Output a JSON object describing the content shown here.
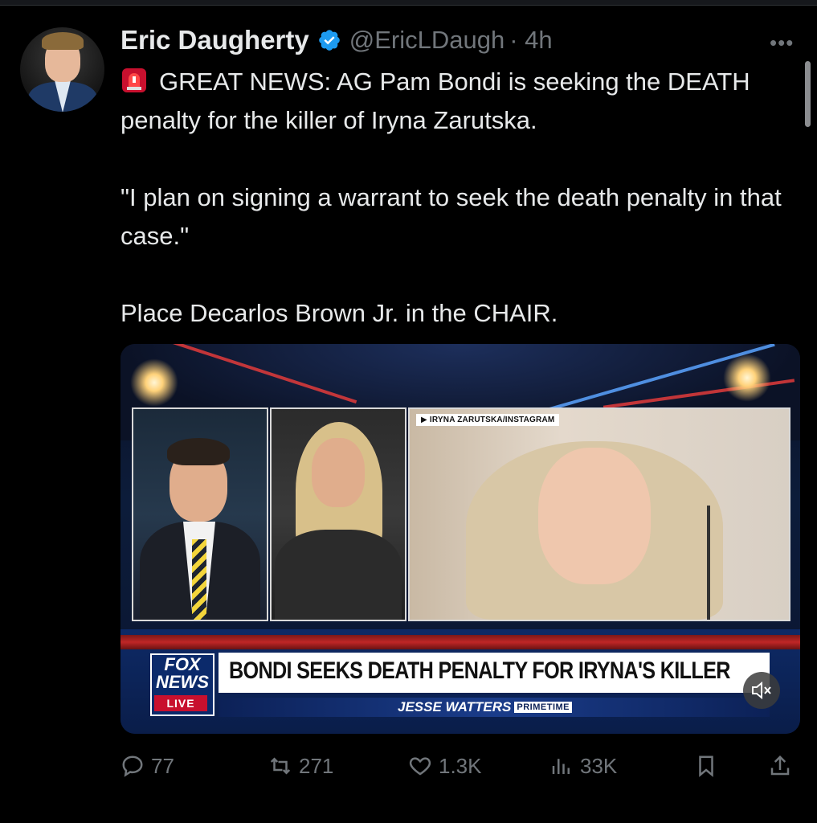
{
  "tweet": {
    "author": {
      "name": "Eric Daugherty",
      "handle": "@EricLDaugh",
      "time": "· 4h",
      "verified": true
    },
    "text": {
      "line1_emoji": "siren-emoji",
      "line1": "GREAT NEWS: AG Pam Bondi is seeking the DEATH penalty for the killer of Iryna Zarutska.",
      "line2": "\"I plan on signing a warrant to seek the death penalty in that case.\"",
      "line3": "Place Decarlos Brown Jr. in the CHAIR."
    },
    "media": {
      "credit": "▶ IRYNA ZARUTSKA/INSTAGRAM",
      "logo_top": "FOX",
      "logo_bottom": "NEWS",
      "logo_live": "LIVE",
      "headline": "BONDI SEEKS DEATH PENALTY FOR IRYNA'S KILLER",
      "show": "JESSE WATTERS",
      "show_tag": "PRIMETIME"
    },
    "actions": {
      "replies": "77",
      "reposts": "271",
      "likes": "1.3K",
      "views": "33K"
    },
    "more_label": "•••"
  },
  "colors": {
    "background": "#000000",
    "text": "#e7e9ea",
    "muted": "#71767b",
    "verified": "#1d9bf0",
    "fox_red": "#c8102e",
    "fox_blue": "#0b2a6b"
  }
}
